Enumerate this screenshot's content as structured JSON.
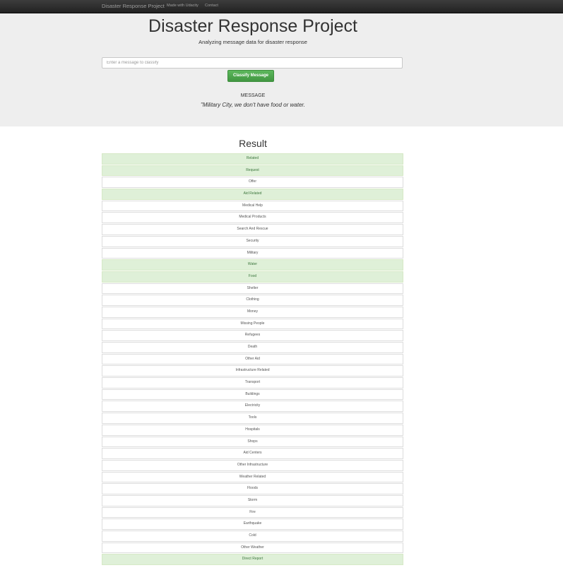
{
  "navbar": {
    "brand": "Disaster Response Project",
    "links": [
      "Made with Udacity",
      "Contact"
    ]
  },
  "header": {
    "title": "Disaster Response Project",
    "subtitle": "Analyzing message data for disaster response"
  },
  "form": {
    "placeholder": "Enter a message to classify",
    "value": "",
    "button_label": "Classify Message"
  },
  "message": {
    "label": "MESSAGE",
    "text": "\"Military City, we don't have food or water."
  },
  "result": {
    "title": "Result",
    "highlight_color": "#dff0d8",
    "categories": [
      {
        "label": "Related",
        "positive": true
      },
      {
        "label": "Request",
        "positive": true
      },
      {
        "label": "Offer",
        "positive": false
      },
      {
        "label": "Aid Related",
        "positive": true
      },
      {
        "label": "Medical Help",
        "positive": false
      },
      {
        "label": "Medical Products",
        "positive": false
      },
      {
        "label": "Search And Rescue",
        "positive": false
      },
      {
        "label": "Security",
        "positive": false
      },
      {
        "label": "Military",
        "positive": false
      },
      {
        "label": "Water",
        "positive": true
      },
      {
        "label": "Food",
        "positive": true
      },
      {
        "label": "Shelter",
        "positive": false
      },
      {
        "label": "Clothing",
        "positive": false
      },
      {
        "label": "Money",
        "positive": false
      },
      {
        "label": "Missing People",
        "positive": false
      },
      {
        "label": "Refugees",
        "positive": false
      },
      {
        "label": "Death",
        "positive": false
      },
      {
        "label": "Other Aid",
        "positive": false
      },
      {
        "label": "Infrastructure Related",
        "positive": false
      },
      {
        "label": "Transport",
        "positive": false
      },
      {
        "label": "Buildings",
        "positive": false
      },
      {
        "label": "Electricity",
        "positive": false
      },
      {
        "label": "Tools",
        "positive": false
      },
      {
        "label": "Hospitals",
        "positive": false
      },
      {
        "label": "Shops",
        "positive": false
      },
      {
        "label": "Aid Centers",
        "positive": false
      },
      {
        "label": "Other Infrastructure",
        "positive": false
      },
      {
        "label": "Weather Related",
        "positive": false
      },
      {
        "label": "Floods",
        "positive": false
      },
      {
        "label": "Storm",
        "positive": false
      },
      {
        "label": "Fire",
        "positive": false
      },
      {
        "label": "Earthquake",
        "positive": false
      },
      {
        "label": "Cold",
        "positive": false
      },
      {
        "label": "Other Weather",
        "positive": false
      },
      {
        "label": "Direct Report",
        "positive": true
      }
    ]
  }
}
